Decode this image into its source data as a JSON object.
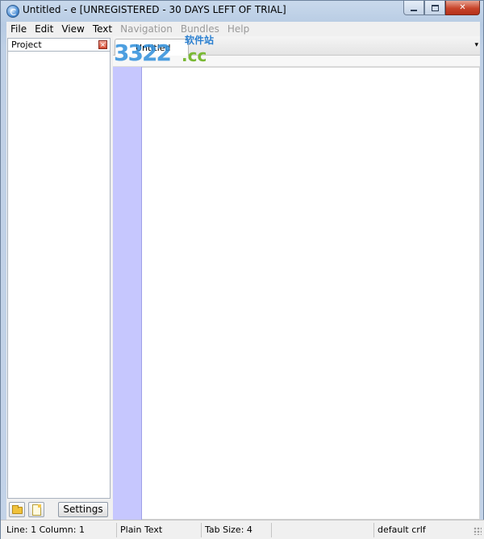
{
  "window": {
    "title": "Untitled - e  [UNREGISTERED - 30 DAYS LEFT OF TRIAL]",
    "icon": "e-app-icon"
  },
  "menu": [
    "File",
    "Edit",
    "View",
    "Text",
    "Navigation",
    "Bundles",
    "Help"
  ],
  "project_panel": {
    "title": "Project",
    "close_icon": "close-icon",
    "settings_label": "Settings"
  },
  "editor": {
    "tab_label": "Untitled",
    "dropdown_icon": "▾"
  },
  "watermark": {
    "number": "3322",
    "cn_text": "软件站",
    "suffix": ".cc"
  },
  "statusbar": {
    "position": "Line: 1  Column: 1",
    "syntax": "Plain Text",
    "tab_size": "Tab Size: 4",
    "encoding": "default crlf"
  },
  "colors": {
    "gutter": "#c6c7fe",
    "frame": "#bfd0e6"
  }
}
